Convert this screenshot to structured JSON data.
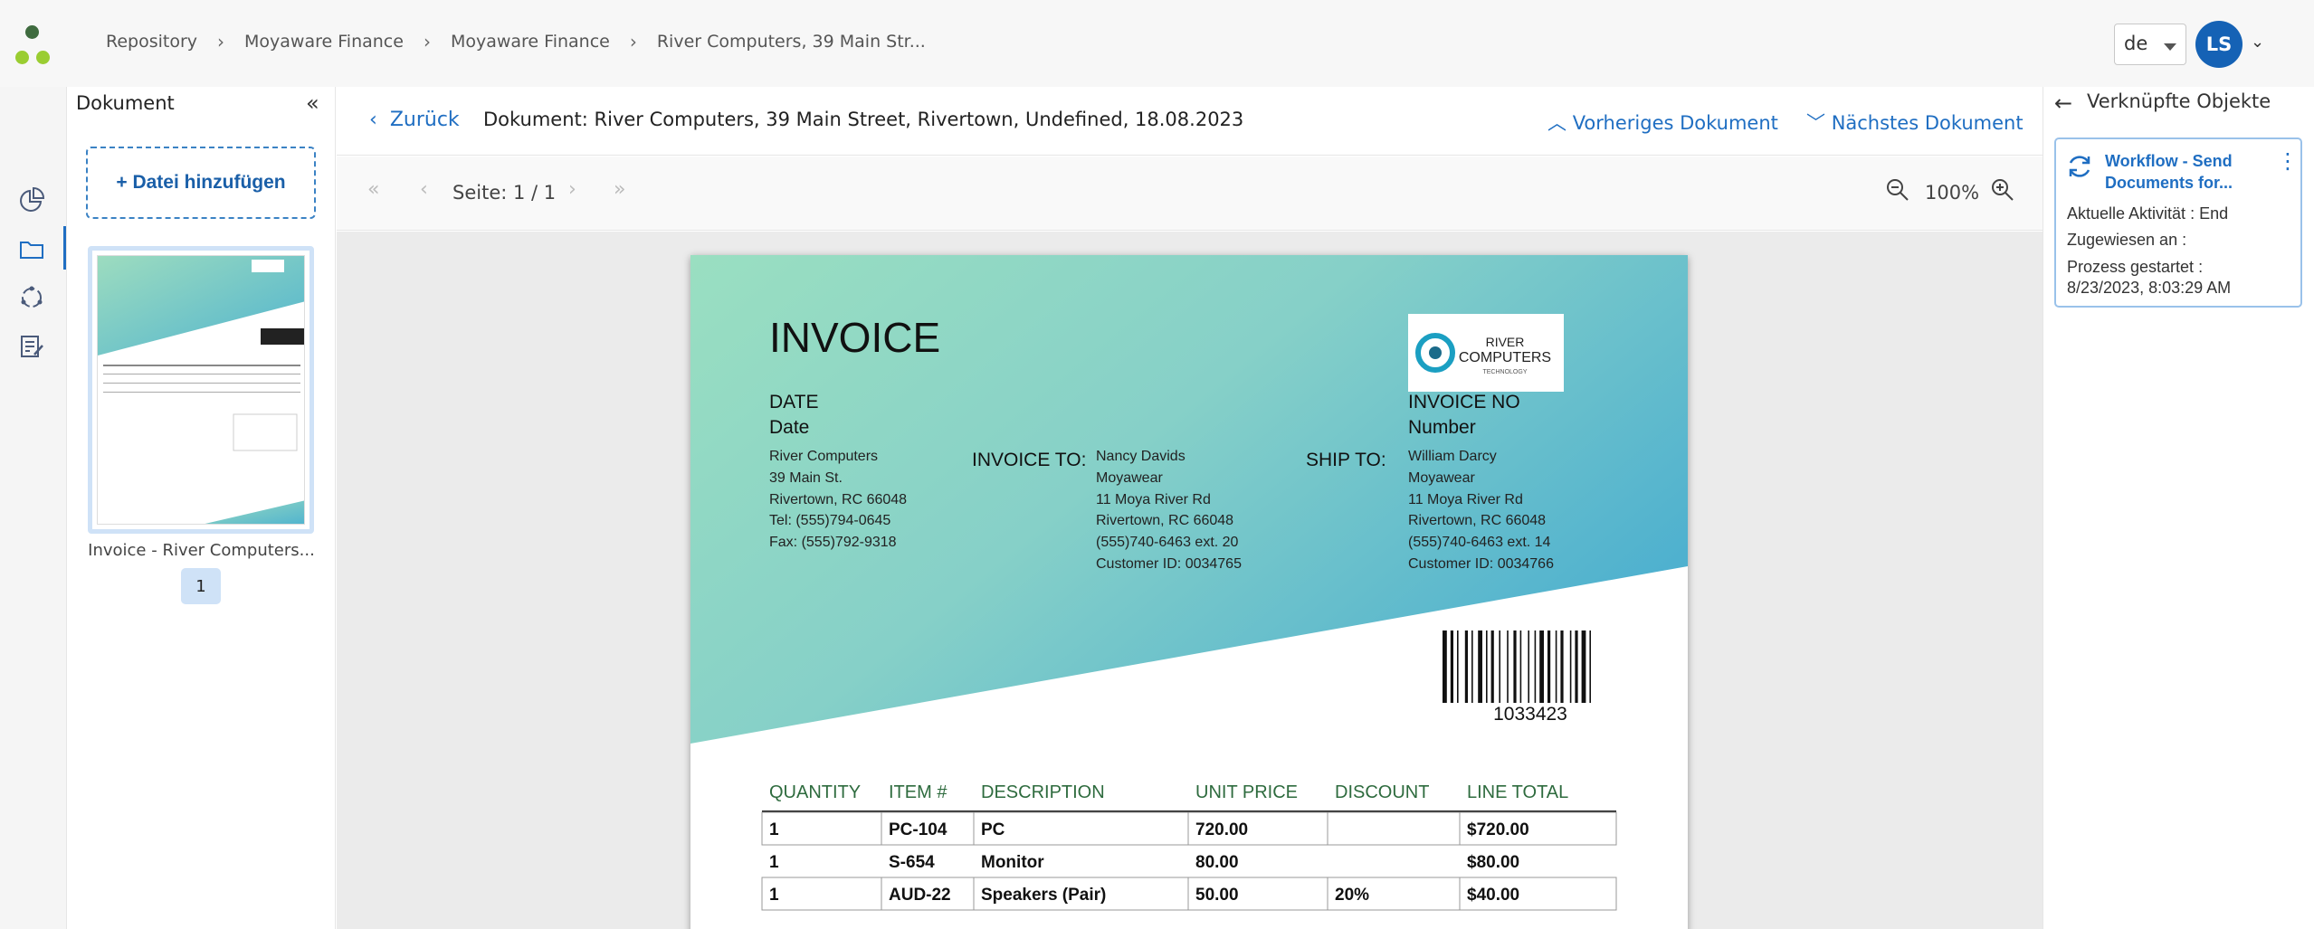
{
  "header": {
    "breadcrumb": [
      "Repository",
      "Moyaware Finance",
      "Moyaware Finance",
      "River Computers, 39 Main Str..."
    ],
    "language": "de",
    "user_initials": "LS"
  },
  "colors": {
    "accent": "#1f6ec2",
    "avatar": "#1562b5",
    "logo_green": "#9acd32",
    "logo_dark": "#3f6b3f"
  },
  "docpanel": {
    "title": "Dokument",
    "add_file": "+ Datei hinzufügen",
    "thumb_label": "Invoice - River Computers...",
    "page_number": "1"
  },
  "main": {
    "back": "Zurück",
    "doc_title": "Dokument: River Computers, 39 Main Street, Rivertown, Undefined, 18.08.2023",
    "prev_doc": "Vorheriges Dokument",
    "next_doc": "Nächstes Dokument",
    "page_info": "Seite: 1 / 1",
    "zoom": "100%"
  },
  "invoice": {
    "title": "INVOICE",
    "date_label": "DATE",
    "date_value": "Date",
    "invoice_no_label": "INVOICE NO",
    "invoice_no_value": "Number",
    "from": [
      "River Computers",
      "39 Main St.",
      "Rivertown, RC 66048",
      "Tel: (555)794-0645",
      "Fax: (555)792-9318"
    ],
    "invoice_to_label": "INVOICE TO:",
    "invoice_to": [
      "Nancy Davids",
      "Moyawear",
      "11 Moya River Rd",
      "Rivertown, RC 66048",
      "(555)740-6463 ext. 20",
      "Customer ID: 0034765"
    ],
    "ship_to_label": "SHIP TO:",
    "ship_to": [
      "William Darcy",
      "Moyawear",
      "11 Moya River Rd",
      "Rivertown, RC 66048",
      "(555)740-6463 ext. 14",
      "Customer ID: 0034766"
    ],
    "logo_line1": "RIVER",
    "logo_line2": "COMPUTERS",
    "logo_line3": "TECHNOLOGY",
    "barcode_number": "1033423",
    "columns": [
      "QUANTITY",
      "ITEM #",
      "DESCRIPTION",
      "UNIT PRICE",
      "DISCOUNT",
      "LINE TOTAL"
    ],
    "rows": [
      [
        "1",
        "PC-104",
        "PC",
        "720.00",
        "",
        "$720.00"
      ],
      [
        "1",
        "S-654",
        "Monitor",
        "80.00",
        "",
        "$80.00"
      ],
      [
        "1",
        "AUD-22",
        "Speakers (Pair)",
        "50.00",
        "20%",
        "$40.00"
      ]
    ]
  },
  "rightpanel": {
    "title": "Verknüpfte Objekte",
    "workflow_title": "Workflow - Send Documents for...",
    "activity": "Aktuelle Aktivität : End",
    "assigned": "Zugewiesen an :",
    "started_label": "Prozess gestartet :",
    "started_value": "8/23/2023, 8:03:29 AM"
  }
}
